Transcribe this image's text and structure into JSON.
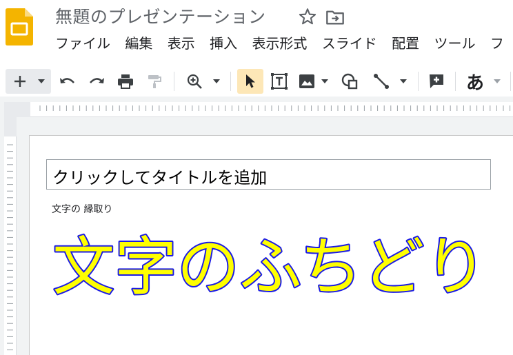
{
  "app": {
    "title": "無題のプレゼンテーション",
    "accent_color": "#F4B400"
  },
  "menubar": {
    "items": [
      "ファイル",
      "編集",
      "表示",
      "挿入",
      "表示形式",
      "スライド",
      "配置",
      "ツール",
      "フ"
    ]
  },
  "toolbar": {
    "icons": [
      "plus-icon",
      "chevron-down-icon",
      "undo-icon",
      "redo-icon",
      "print-icon",
      "paint-format-icon",
      "zoom-icon",
      "chevron-down-icon",
      "cursor-icon",
      "text-box-icon",
      "image-icon",
      "shape-icon",
      "line-icon",
      "add-comment-icon"
    ],
    "font_char": "あ"
  },
  "slide": {
    "title_placeholder": "クリックしてタイトルを追加",
    "subtitle": "文字の 縁取り",
    "word_art": {
      "text": "文字のふちどり",
      "fill_color": "#FFFF00",
      "stroke_color": "#1A1AE6"
    }
  }
}
